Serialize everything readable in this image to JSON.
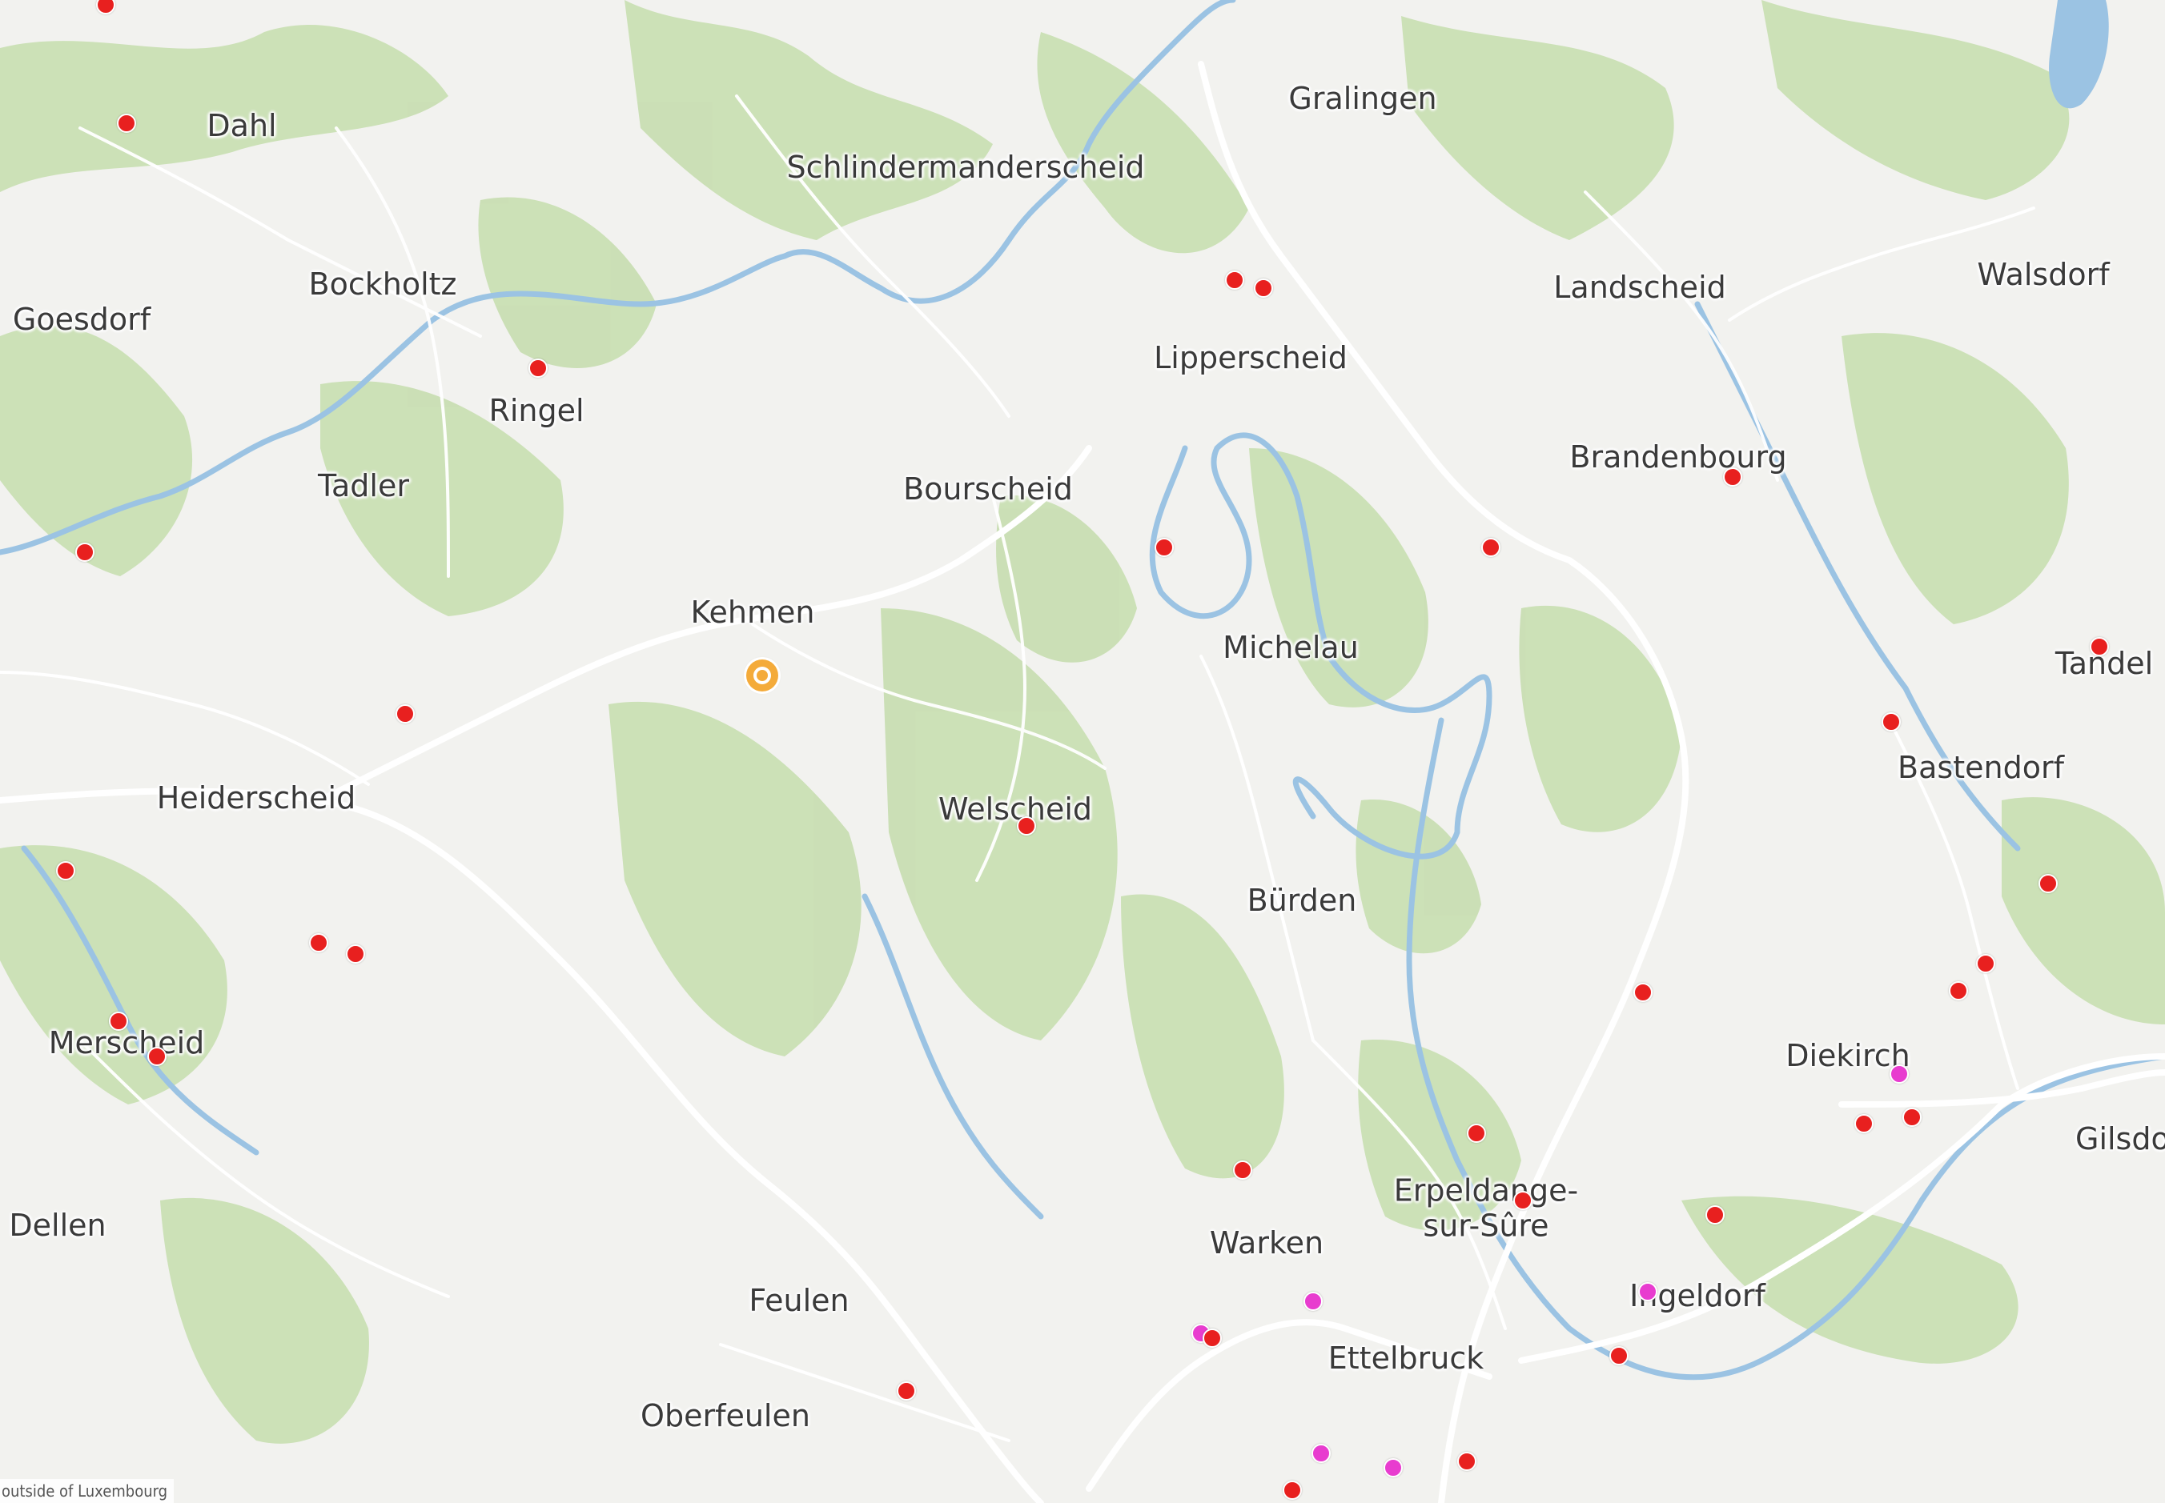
{
  "map": {
    "attribution": "outside of Luxembourg",
    "colors": {
      "land": "#f2f2ef",
      "forest": "#c5dcae",
      "water": "#9bc3e3",
      "road": "#ffffff",
      "poi": "#e8201f",
      "poi_alt": "#e83ccf",
      "selected": "#f4ab3a"
    },
    "places": [
      {
        "name": "Dahl"
      },
      {
        "name": "Gralingen"
      },
      {
        "name": "Schlindermanderscheid"
      },
      {
        "name": "Walsdorf"
      },
      {
        "name": "Bockholtz"
      },
      {
        "name": "Goesdorf"
      },
      {
        "name": "Landscheid"
      },
      {
        "name": "Lipperscheid"
      },
      {
        "name": "Ringel"
      },
      {
        "name": "Brandenbourg"
      },
      {
        "name": "Tadler"
      },
      {
        "name": "Bourscheid"
      },
      {
        "name": "Kehmen"
      },
      {
        "name": "Michelau"
      },
      {
        "name": "Tandel"
      },
      {
        "name": "Bastendorf"
      },
      {
        "name": "Heiderscheid"
      },
      {
        "name": "Welscheid"
      },
      {
        "name": "Bürden"
      },
      {
        "name": "Merscheid"
      },
      {
        "name": "Diekirch"
      },
      {
        "name": "Gilsdo"
      },
      {
        "name": "Erpeldange-"
      },
      {
        "name": "sur-Sûre"
      },
      {
        "name": "Dellen"
      },
      {
        "name": "Warken"
      },
      {
        "name": "Ingeldorf"
      },
      {
        "name": "Feulen"
      },
      {
        "name": "Ettelbruck"
      },
      {
        "name": "Oberfeulen"
      }
    ]
  }
}
